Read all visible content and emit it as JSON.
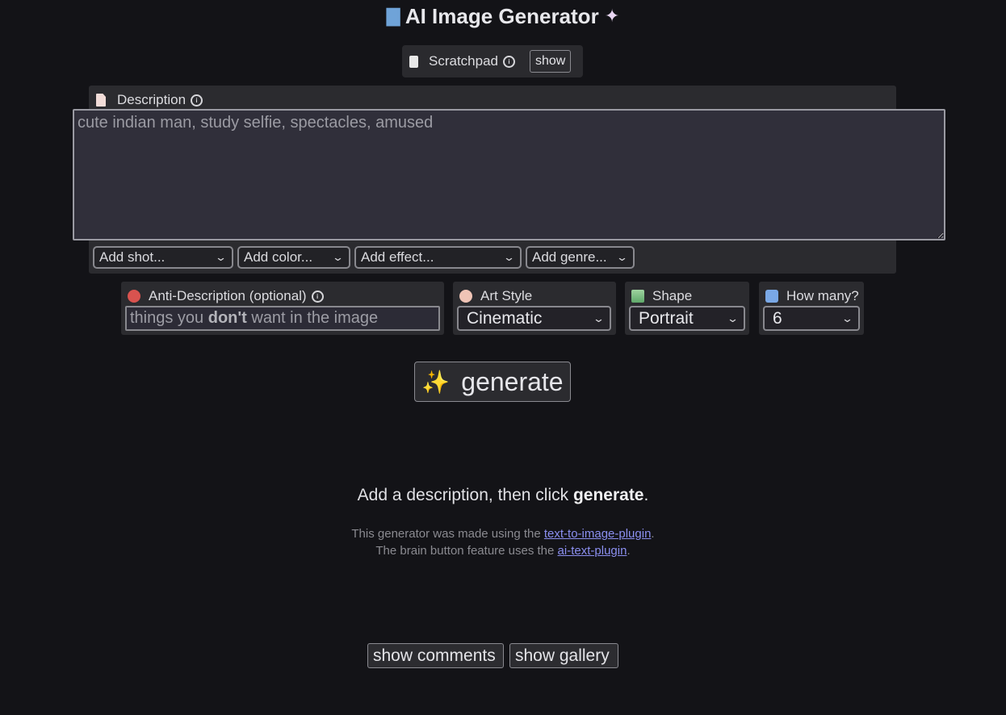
{
  "header": {
    "title": "AI Image Generator",
    "left_icon": "paintbrush-emoji",
    "right_icon": "magic-wand-emoji"
  },
  "scratchpad": {
    "label": "Scratchpad",
    "toggle_label": "show"
  },
  "description": {
    "label": "Description",
    "value": "cute indian man, study selfie, spectacles, amused"
  },
  "modifiers": [
    {
      "label": "Add shot..."
    },
    {
      "label": "Add color..."
    },
    {
      "label": "Add effect..."
    },
    {
      "label": "Add genre..."
    }
  ],
  "options": {
    "anti_description": {
      "label": "Anti-Description (optional)",
      "placeholder_pre": "things you ",
      "placeholder_bold": "don't",
      "placeholder_post": " want in the image"
    },
    "art_style": {
      "label": "Art Style",
      "value": "Cinematic"
    },
    "shape": {
      "label": "Shape",
      "value": "Portrait"
    },
    "how_many": {
      "label": "How many?",
      "value": "6"
    }
  },
  "generate_button": {
    "label": "generate"
  },
  "hint": {
    "pre": "Add a description, then click ",
    "bold": "generate",
    "post": "."
  },
  "credits": {
    "line1_pre": "This generator was made using the ",
    "line1_link": "text-to-image-plugin",
    "line1_post": ".",
    "line2_pre": "The brain button feature uses the ",
    "line2_link": "ai-text-plugin",
    "line2_post": "."
  },
  "footer": {
    "comments_label": "show comments",
    "gallery_label": "show gallery"
  },
  "colors": {
    "background": "#131317",
    "panel": "#2b2b2f",
    "link": "#8b8ff0"
  }
}
